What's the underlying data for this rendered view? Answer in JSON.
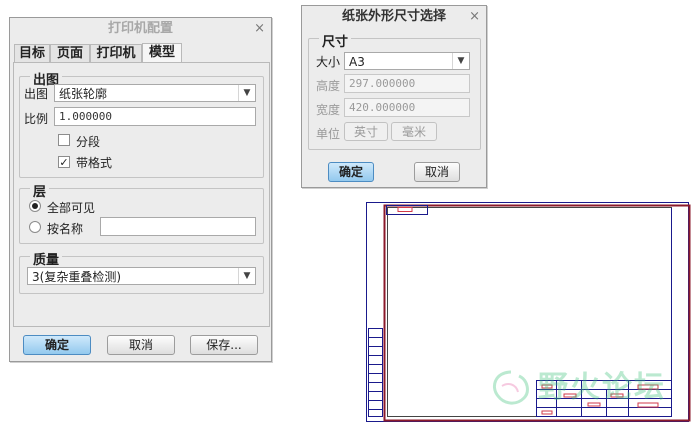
{
  "print_dialog": {
    "title": "打印机配置",
    "close": "×",
    "tabs": [
      "目标",
      "页面",
      "打印机",
      "模型"
    ],
    "output_group": {
      "legend": "出图",
      "output_label": "出图",
      "output_value": "纸张轮廓",
      "scale_label": "比例",
      "scale_value": "1.000000",
      "segment_label": "分段",
      "segment_checked": false,
      "format_label": "带格式",
      "format_checked": true,
      "check_mark": "✓"
    },
    "layer_group": {
      "legend": "层",
      "all_visible_label": "全部可见",
      "by_name_label": "按名称",
      "selected": "all_visible",
      "name_value": ""
    },
    "quality_group": {
      "legend": "质量",
      "value": "3(复杂重叠检测)"
    },
    "buttons": {
      "ok": "确定",
      "cancel": "取消",
      "save": "保存..."
    }
  },
  "paper_dialog": {
    "title": "纸张外形尺寸选择",
    "close": "×",
    "group_legend": "尺寸",
    "size_label": "大小",
    "size_value": "A3",
    "height_label": "高度",
    "height_value": "297.000000",
    "width_label": "宽度",
    "width_value": "420.000000",
    "unit_label": "单位",
    "unit_inch": "英寸",
    "unit_mm": "毫米",
    "ok": "确定",
    "cancel": "取消"
  },
  "icons": {
    "dropdown": "▼"
  },
  "watermark": "野火论坛",
  "colors": {
    "accent_button": "#93c9ee",
    "drawing_frame": "#8b1a2b",
    "drawing_outline": "#1a1a8c"
  }
}
